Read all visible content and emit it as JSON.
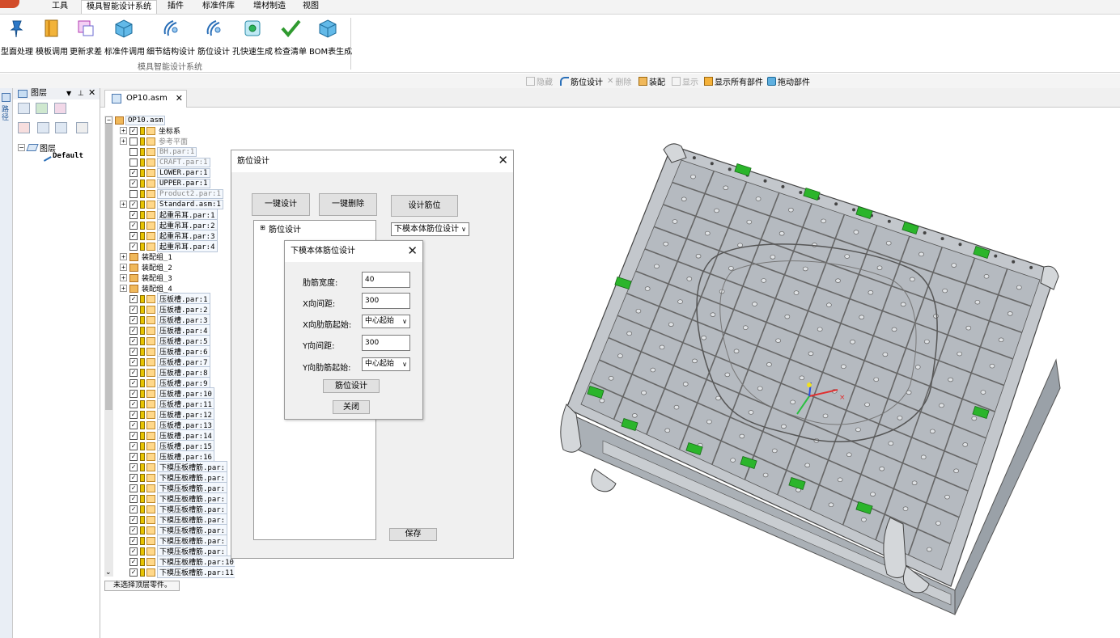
{
  "ribbon": {
    "tabs": [
      "工具",
      "模具智能设计系统",
      "插件",
      "标准件库",
      "增材制造",
      "视图"
    ],
    "active_tab": "模具智能设计系统",
    "buttons": [
      "型面处理",
      "模板调用",
      "更新求差",
      "标准件调用",
      "细节结构设计",
      "筋位设计",
      "孔快速生成",
      "检查清单",
      "BOM表生成"
    ],
    "group_label": "模具智能设计系统"
  },
  "command_strip": {
    "items": [
      {
        "label": "隐藏",
        "enabled": false
      },
      {
        "label": "筋位设计",
        "enabled": true
      },
      {
        "label": "删除",
        "enabled": false
      },
      {
        "label": "装配",
        "enabled": true
      },
      {
        "label": "显示",
        "enabled": false
      },
      {
        "label": "显示所有部件",
        "enabled": true
      },
      {
        "label": "拖动部件",
        "enabled": true
      }
    ]
  },
  "left_tab": {
    "label": "路径"
  },
  "layer_panel": {
    "title": "图层",
    "root": "图层",
    "default_item": "Default"
  },
  "document": {
    "tab_label": "OP10.asm"
  },
  "tree": {
    "root": "OP10.asm",
    "items": [
      {
        "label": "坐标系",
        "checked": true,
        "expand": true,
        "boxed": false
      },
      {
        "label": "参考平面",
        "checked": false,
        "expand": true,
        "boxed": false,
        "gray": true
      },
      {
        "label": "BH.par:1",
        "checked": false,
        "boxed": true,
        "gray": true
      },
      {
        "label": "CRAFT.par:1",
        "checked": false,
        "boxed": true,
        "gray": true
      },
      {
        "label": "LOWER.par:1",
        "checked": true,
        "boxed": true
      },
      {
        "label": "UPPER.par:1",
        "checked": true,
        "boxed": true
      },
      {
        "label": "Product2.par:1",
        "checked": false,
        "boxed": true,
        "gray": true
      },
      {
        "label": "Standard.asm:1",
        "checked": true,
        "expand": true,
        "boxed": true
      },
      {
        "label": "起重吊耳.par:1",
        "checked": true,
        "boxed": true
      },
      {
        "label": "起重吊耳.par:2",
        "checked": true,
        "boxed": true
      },
      {
        "label": "起重吊耳.par:3",
        "checked": true,
        "boxed": true
      },
      {
        "label": "起重吊耳.par:4",
        "checked": true,
        "boxed": true
      },
      {
        "label": "装配组_1",
        "group": true
      },
      {
        "label": "装配组_2",
        "group": true
      },
      {
        "label": "装配组_3",
        "group": true
      },
      {
        "label": "装配组_4",
        "group": true
      },
      {
        "label": "压板槽.par:1",
        "checked": true,
        "boxed": true
      },
      {
        "label": "压板槽.par:2",
        "checked": true,
        "boxed": true
      },
      {
        "label": "压板槽.par:3",
        "checked": true,
        "boxed": true
      },
      {
        "label": "压板槽.par:4",
        "checked": true,
        "boxed": true
      },
      {
        "label": "压板槽.par:5",
        "checked": true,
        "boxed": true
      },
      {
        "label": "压板槽.par:6",
        "checked": true,
        "boxed": true
      },
      {
        "label": "压板槽.par:7",
        "checked": true,
        "boxed": true
      },
      {
        "label": "压板槽.par:8",
        "checked": true,
        "boxed": true
      },
      {
        "label": "压板槽.par:9",
        "checked": true,
        "boxed": true
      },
      {
        "label": "压板槽.par:10",
        "checked": true,
        "boxed": true
      },
      {
        "label": "压板槽.par:11",
        "checked": true,
        "boxed": true
      },
      {
        "label": "压板槽.par:12",
        "checked": true,
        "boxed": true
      },
      {
        "label": "压板槽.par:13",
        "checked": true,
        "boxed": true
      },
      {
        "label": "压板槽.par:14",
        "checked": true,
        "boxed": true
      },
      {
        "label": "压板槽.par:15",
        "checked": true,
        "boxed": true
      },
      {
        "label": "压板槽.par:16",
        "checked": true,
        "boxed": true
      },
      {
        "label": "下模压板槽筋.par:",
        "checked": true,
        "boxed": true
      },
      {
        "label": "下模压板槽筋.par:",
        "checked": true,
        "boxed": true
      },
      {
        "label": "下模压板槽筋.par:",
        "checked": true,
        "boxed": true
      },
      {
        "label": "下模压板槽筋.par:",
        "checked": true,
        "boxed": true
      },
      {
        "label": "下模压板槽筋.par:",
        "checked": true,
        "boxed": true
      },
      {
        "label": "下模压板槽筋.par:",
        "checked": true,
        "boxed": true
      },
      {
        "label": "下模压板槽筋.par:",
        "checked": true,
        "boxed": true
      },
      {
        "label": "下模压板槽筋.par:",
        "checked": true,
        "boxed": true
      },
      {
        "label": "下模压板槽筋.par:",
        "checked": true,
        "boxed": true
      },
      {
        "label": "下模压板槽筋.par:10",
        "checked": true,
        "boxed": true
      },
      {
        "label": "下模压板槽筋.par:11",
        "checked": true,
        "boxed": true
      }
    ],
    "status": "未选择顶层零件。"
  },
  "dialog_rib": {
    "title": "筋位设计",
    "btn_one_click_design": "一键设计",
    "btn_one_click_delete": "一键删除",
    "btn_design_rib": "设计筋位",
    "mode_select": "下模本体筋位设计",
    "tree_root": "筋位设计",
    "btn_save": "保存"
  },
  "dialog_lower": {
    "title": "下模本体筋位设计",
    "fields": [
      {
        "label": "肋筋宽度:",
        "value": "40",
        "type": "input"
      },
      {
        "label": "X向间距:",
        "value": "300",
        "type": "input"
      },
      {
        "label": "X向肋筋起始:",
        "value": "中心起始",
        "type": "select"
      },
      {
        "label": "Y向间距:",
        "value": "300",
        "type": "input"
      },
      {
        "label": "Y向肋筋起始:",
        "value": "中心起始",
        "type": "select"
      }
    ],
    "btn_design": "筋位设计",
    "btn_close": "关闭"
  },
  "colors": {
    "accent": "#1e6fd0",
    "mold_gray": "#b9bdc2",
    "green": "#2bb52b"
  }
}
